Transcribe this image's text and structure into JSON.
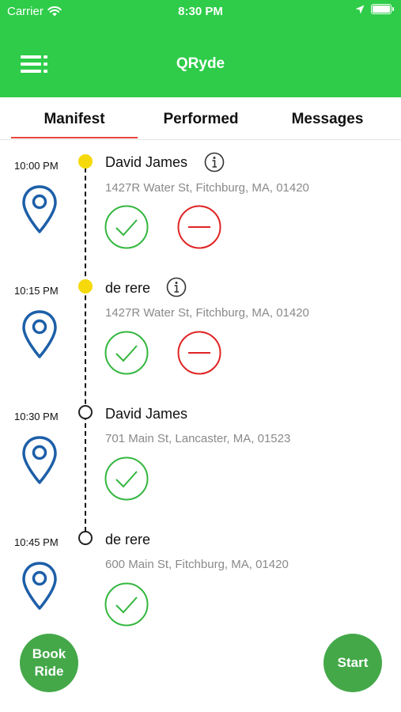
{
  "status_bar": {
    "carrier": "Carrier",
    "time": "8:30 PM",
    "battery_level": 1.0
  },
  "header": {
    "title": "QRyde"
  },
  "tabs": [
    {
      "label": "Manifest",
      "selected": true
    },
    {
      "label": "Performed",
      "selected": false
    },
    {
      "label": "Messages",
      "selected": false
    }
  ],
  "stops": [
    {
      "time": "10:00 PM",
      "name": "David James",
      "address": "1427R Water St, Fitchburg, MA, 01420",
      "status": "active",
      "has_info": true,
      "has_remove": true
    },
    {
      "time": "10:15 PM",
      "name": "de rere",
      "address": "1427R Water St, Fitchburg, MA, 01420",
      "status": "active",
      "has_info": true,
      "has_remove": true
    },
    {
      "time": "10:30 PM",
      "name": "David James",
      "address": "701 Main St, Lancaster, MA, 01523",
      "status": "pending",
      "has_info": false,
      "has_remove": false
    },
    {
      "time": "10:45 PM",
      "name": "de rere",
      "address": "600 Main St, Fitchburg, MA, 01420",
      "status": "pending",
      "has_info": false,
      "has_remove": false
    }
  ],
  "actions": {
    "book_ride_line1": "Book",
    "book_ride_line2": "Ride",
    "start": "Start"
  },
  "colors": {
    "header_green": "#2ecc49",
    "active_dot": "#f5d90a",
    "confirm_green": "#34b73f",
    "cancel_red": "#e02424",
    "pin_blue": "#1d5fa8",
    "tab_underline": "#e8443a",
    "fab_green": "#44a849"
  },
  "icons": [
    "menu-icon",
    "wifi-icon",
    "location-arrow-icon",
    "battery-icon",
    "map-pin-icon",
    "info-icon",
    "checkmark-icon",
    "minus-icon"
  ]
}
